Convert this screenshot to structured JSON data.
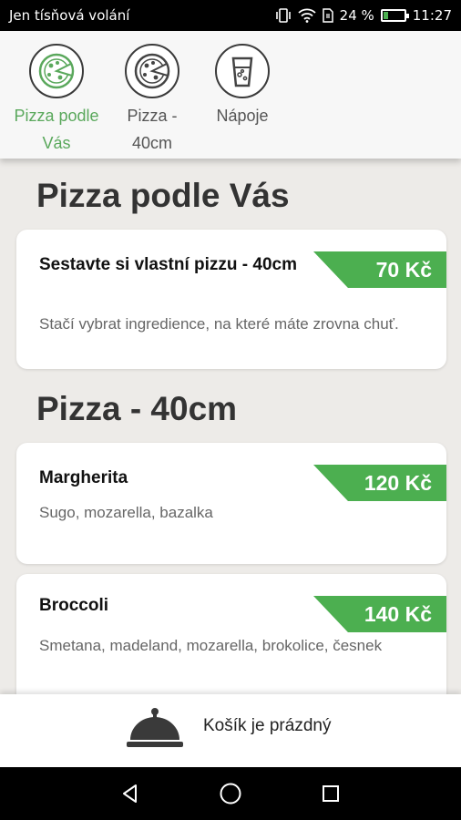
{
  "status_bar": {
    "carrier": "Jen tísňová volání",
    "battery": "24 %",
    "battery_level": 0.24,
    "time": "11:27",
    "icons": [
      "vibrate-icon",
      "wifi-icon",
      "sim-icon",
      "battery-icon"
    ]
  },
  "categories": [
    {
      "label": "Pizza podle\nVás",
      "icon": "pizza-icon",
      "active": true
    },
    {
      "label": "Pizza -\n40cm",
      "icon": "pizza-icon",
      "active": false
    },
    {
      "label": "Nápoje",
      "icon": "drink-icon",
      "active": false
    }
  ],
  "sections": [
    {
      "title": "Pizza podle Vás",
      "items": [
        {
          "name": "Sestavte si vlastní pizzu - 40cm",
          "price": "70 Kč",
          "description": "Stačí vybrat ingredience, na které máte zrovna chuť."
        }
      ]
    },
    {
      "title": "Pizza - 40cm",
      "items": [
        {
          "name": "Margherita",
          "price": "120 Kč",
          "description": "Sugo, mozarella, bazalka"
        },
        {
          "name": "Broccoli",
          "price": "140 Kč",
          "description": "Smetana, madeland, mozarella, brokolice, česnek"
        }
      ]
    }
  ],
  "cart": {
    "label": "Košík je prázdný",
    "icon": "cloche-icon"
  },
  "colors": {
    "accent": "#4caf50",
    "active_text": "#5aa85c"
  }
}
